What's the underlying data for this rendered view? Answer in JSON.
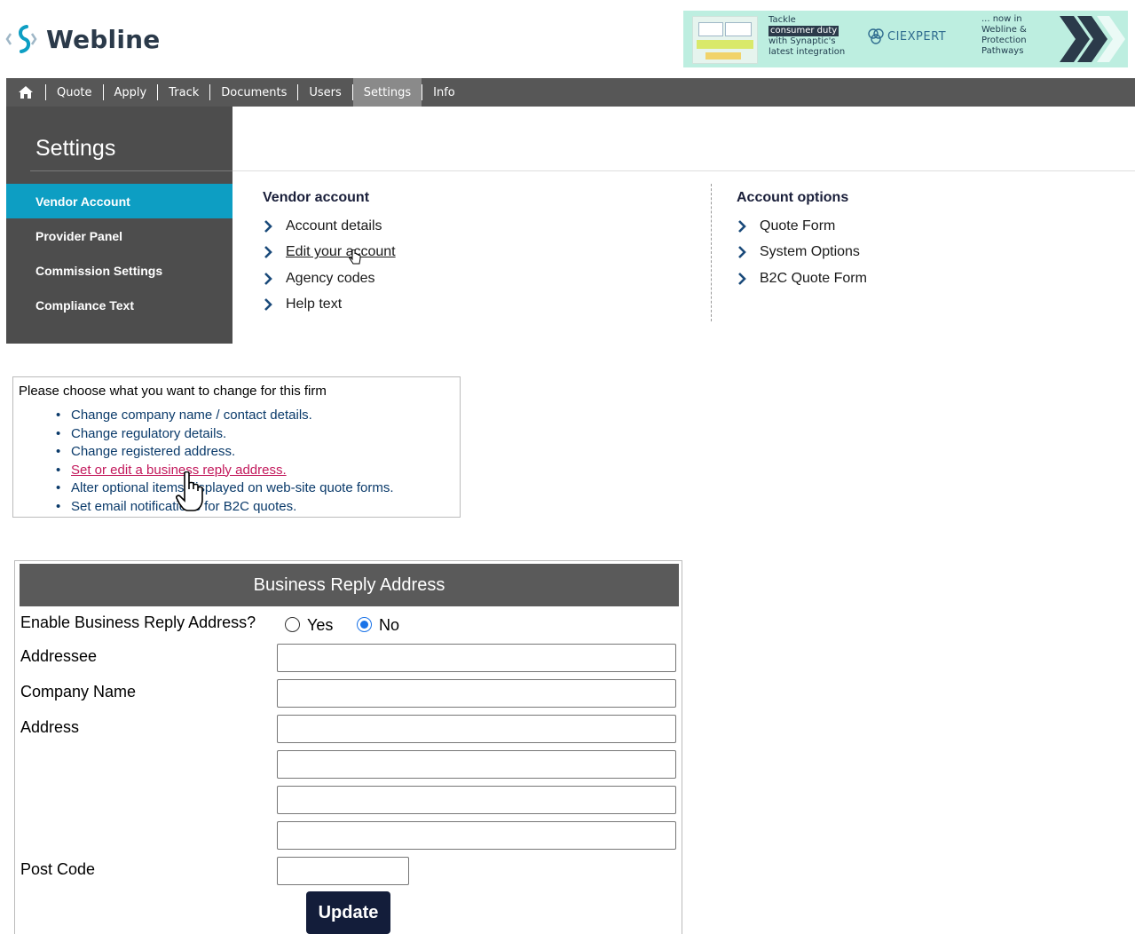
{
  "header": {
    "logo_text": "Webline",
    "banner": {
      "tackle": "Tackle",
      "highlight": "consumer duty",
      "line3": "with Synaptic's",
      "line4": "latest integration",
      "brand": "CIEXPERT",
      "right1": "... now in",
      "right2": "Webline &",
      "right3": "Protection",
      "right4": "Pathways"
    }
  },
  "nav": {
    "home_icon": "home-icon",
    "items": [
      "Quote",
      "Apply",
      "Track",
      "Documents",
      "Users",
      "Settings",
      "Info"
    ],
    "active": "Settings"
  },
  "sidebar": {
    "title": "Settings",
    "items": [
      "Vendor Account",
      "Provider Panel",
      "Commission Settings",
      "Compliance Text"
    ],
    "active": "Vendor Account",
    "accent": "#0d9ec3"
  },
  "vendor": {
    "title": "Vendor account",
    "links": [
      "Account details",
      "Edit your account",
      "Agency codes",
      "Help text"
    ]
  },
  "options": {
    "title": "Account options",
    "links": [
      "Quote Form",
      "System Options",
      "B2C Quote Form"
    ]
  },
  "change": {
    "title": "Please choose what you want to change for this firm",
    "items": [
      "Change company name / contact details.",
      "Change regulatory details.",
      "Change registered address.",
      "Set or edit a business reply address.",
      "Alter optional items displayed on web-site quote forms.",
      "Set email notifications for B2C quotes."
    ]
  },
  "form": {
    "header": "Business Reply Address",
    "enable_label": "Enable Business Reply Address?",
    "yes": "Yes",
    "no": "No",
    "selected": "No",
    "addressee_label": "Addressee",
    "company_label": "Company Name",
    "address_label": "Address",
    "postcode_label": "Post Code",
    "update_label": "Update",
    "values": {
      "addressee": "",
      "company": "",
      "address1": "",
      "address2": "",
      "address3": "",
      "address4": "",
      "postcode": ""
    }
  }
}
